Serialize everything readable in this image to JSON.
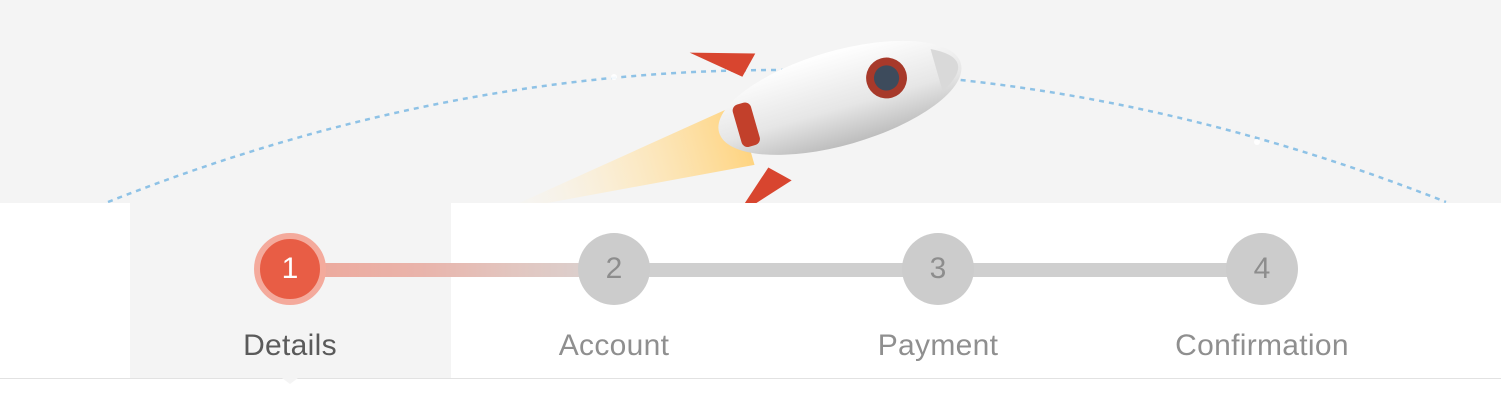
{
  "colors": {
    "accent": "#e85d45",
    "accent_ring": "#f4aa9c",
    "inactive": "#cccccc",
    "trajectory": "#8ec2e6",
    "hero_background": "#f4f4f4"
  },
  "hero": {
    "illustration": "rocket-icon",
    "trajectory": "dashed-arc"
  },
  "stepper": {
    "active_step": 1,
    "steps": [
      {
        "number": "1",
        "label": "Details",
        "state": "active"
      },
      {
        "number": "2",
        "label": "Account",
        "state": "upcoming"
      },
      {
        "number": "3",
        "label": "Payment",
        "state": "upcoming"
      },
      {
        "number": "4",
        "label": "Confirmation",
        "state": "upcoming"
      }
    ]
  }
}
